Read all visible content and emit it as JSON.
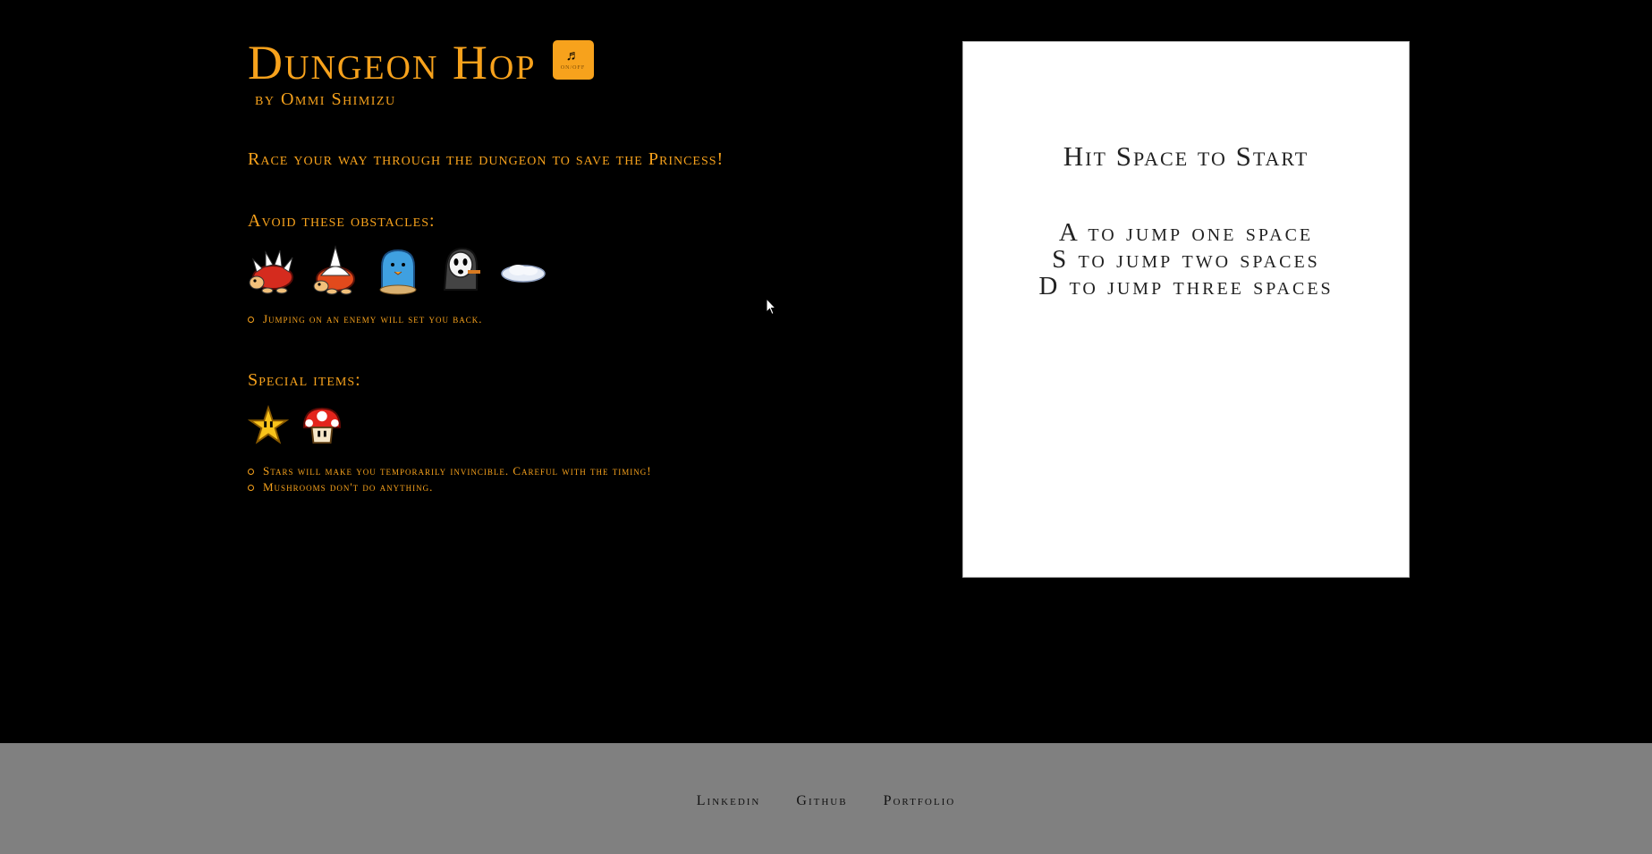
{
  "header": {
    "title": "Dungeon Hop",
    "music_button": {
      "icon": "music-note-icon",
      "label": "ON/OFF"
    },
    "byline": "by Ommi Shimizu"
  },
  "tagline": "Race your way through the dungeon to save the Princess!",
  "obstacles": {
    "heading": "Avoid these obstacles:",
    "icons": [
      "red-spiny-icon",
      "spike-shell-icon",
      "blue-ghost-icon",
      "shy-guy-icon",
      "cloud-icon"
    ],
    "notes": [
      "Jumping on an enemy will set you back."
    ]
  },
  "items": {
    "heading": "Special items:",
    "icons": [
      "star-icon",
      "mushroom-icon"
    ],
    "notes": [
      "Stars will make you temporarily invincible. Careful with the timing!",
      "Mushrooms don't do anything."
    ]
  },
  "game": {
    "start_text": "Hit Space to Start",
    "controls": [
      "A to jump one space",
      "S to jump two spaces",
      "D to jump three spaces"
    ]
  },
  "footer": {
    "links": [
      "Linkedin",
      "Github",
      "Portfolio"
    ]
  },
  "colors": {
    "accent": "#f7a21c",
    "background": "#000000",
    "footer_bg": "#808080",
    "panel_bg": "#ffffff"
  }
}
